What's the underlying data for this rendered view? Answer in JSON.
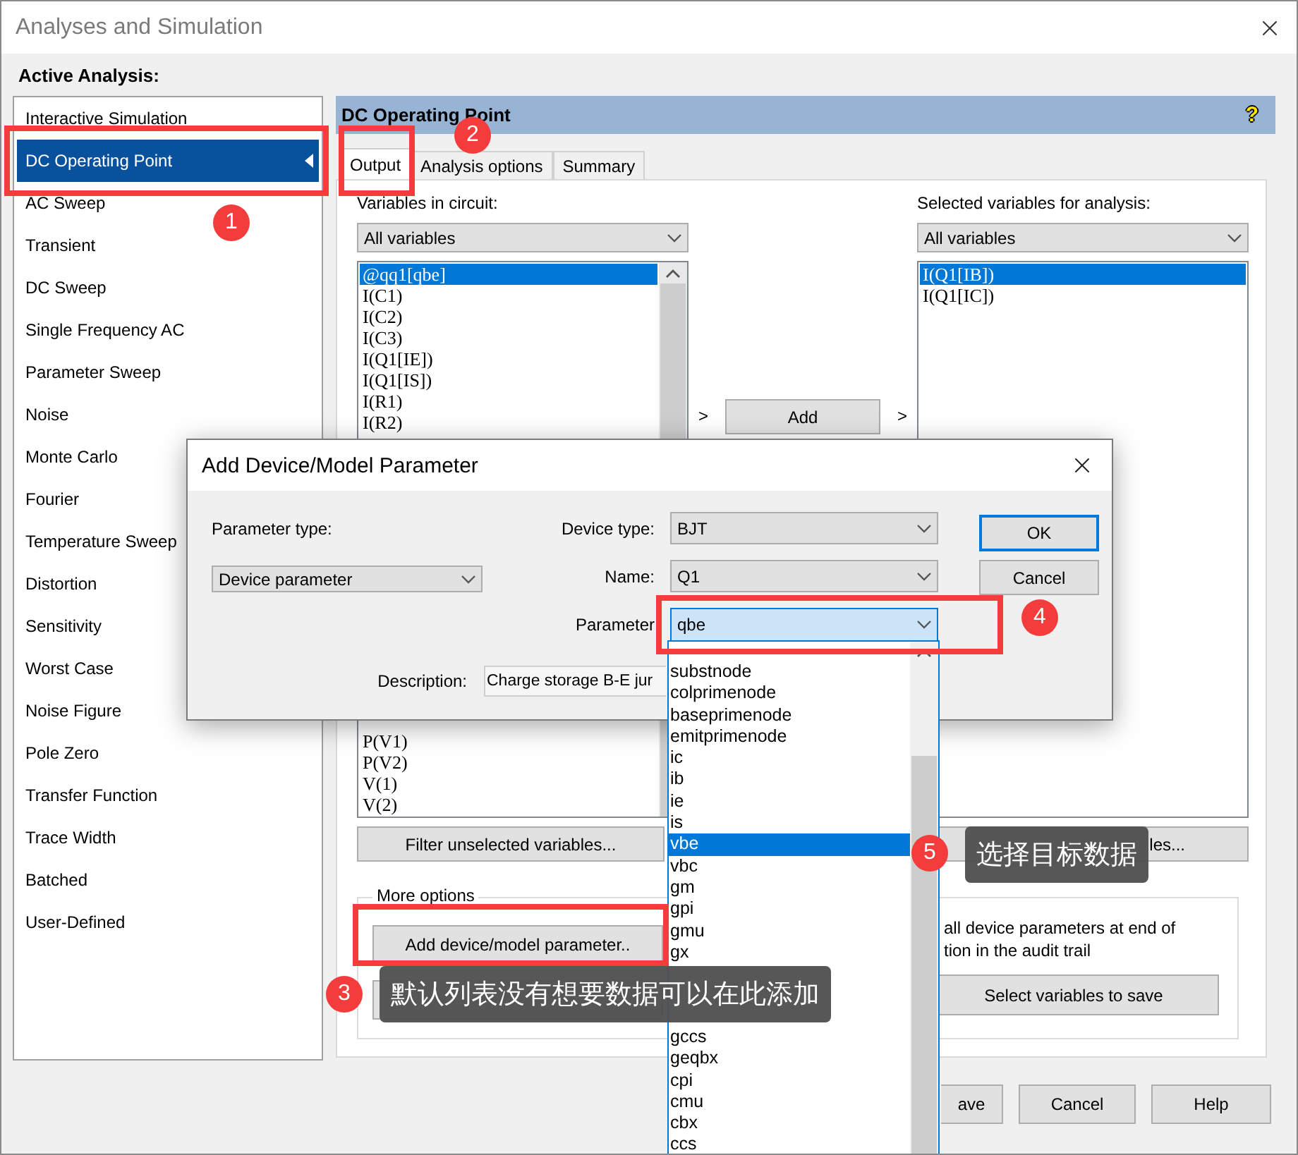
{
  "window": {
    "title": "Analyses and Simulation"
  },
  "active_analysis_label": "Active Analysis:",
  "analyses": [
    {
      "label": "Interactive Simulation",
      "selected": false
    },
    {
      "label": "DC Operating Point",
      "selected": true
    },
    {
      "label": "AC Sweep",
      "selected": false
    },
    {
      "label": "Transient",
      "selected": false
    },
    {
      "label": "DC Sweep",
      "selected": false
    },
    {
      "label": "Single Frequency AC",
      "selected": false
    },
    {
      "label": "Parameter Sweep",
      "selected": false
    },
    {
      "label": "Noise",
      "selected": false
    },
    {
      "label": "Monte Carlo",
      "selected": false
    },
    {
      "label": "Fourier",
      "selected": false
    },
    {
      "label": "Temperature Sweep",
      "selected": false
    },
    {
      "label": "Distortion",
      "selected": false
    },
    {
      "label": "Sensitivity",
      "selected": false
    },
    {
      "label": "Worst Case",
      "selected": false
    },
    {
      "label": "Noise Figure",
      "selected": false
    },
    {
      "label": "Pole Zero",
      "selected": false
    },
    {
      "label": "Transfer Function",
      "selected": false
    },
    {
      "label": "Trace Width",
      "selected": false
    },
    {
      "label": "Batched",
      "selected": false
    },
    {
      "label": "User-Defined",
      "selected": false
    }
  ],
  "panel": {
    "title": "DC Operating Point",
    "help": "?"
  },
  "tabs": [
    {
      "label": "Output",
      "selected": true
    },
    {
      "label": "Analysis options",
      "selected": false
    },
    {
      "label": "Summary",
      "selected": false
    }
  ],
  "variables_in_circuit": {
    "label": "Variables in circuit:",
    "filter": "All variables",
    "items_top": [
      {
        "label": "@qq1[qbe]",
        "selected": true
      },
      {
        "label": "I(C1)",
        "selected": false
      },
      {
        "label": "I(C2)",
        "selected": false
      },
      {
        "label": "I(C3)",
        "selected": false
      },
      {
        "label": "I(Q1[IE])",
        "selected": false
      },
      {
        "label": "I(Q1[IS])",
        "selected": false
      },
      {
        "label": "I(R1)",
        "selected": false
      },
      {
        "label": "I(R2)",
        "selected": false
      }
    ],
    "items_bottom": [
      {
        "label": "P(V1)",
        "selected": false
      },
      {
        "label": "P(V2)",
        "selected": false
      },
      {
        "label": "V(1)",
        "selected": false
      },
      {
        "label": "V(2)",
        "selected": false
      }
    ]
  },
  "add_section": {
    "left_arrow": ">",
    "button": "Add",
    "right_arrow": ">"
  },
  "selected_variables": {
    "label": "Selected variables for analysis:",
    "filter": "All variables",
    "items": [
      {
        "label": "I(Q1[IB])",
        "selected": true
      },
      {
        "label": "I(Q1[IC])",
        "selected": false
      }
    ]
  },
  "filter_buttons": [
    "Filter unselected variables...",
    "les..."
  ],
  "more_options": {
    "legend": "More options",
    "add_button": "Add device/model parameter..",
    "note_lines": [
      "all device parameters at end of",
      "tion in the audit trail"
    ],
    "save_button": "Select variables to save"
  },
  "footer_buttons": [
    "ave",
    "Cancel",
    "Help"
  ],
  "dialog": {
    "title": "Add Device/Model Parameter",
    "parameter_type": {
      "label": "Parameter type:",
      "value": "Device parameter"
    },
    "fields": [
      {
        "label": "Device type:",
        "value": "BJT",
        "focused": false
      },
      {
        "label": "Name:",
        "value": "Q1",
        "focused": false
      },
      {
        "label": "Parameter",
        "value": "qbe",
        "focused": true
      }
    ],
    "buttons": [
      {
        "label": "OK",
        "default": true
      },
      {
        "label": "Cancel",
        "default": false
      }
    ],
    "description": {
      "label": "Description:",
      "value": "Charge storage B-E jur"
    }
  },
  "parameter_list": {
    "items_top": [
      {
        "label": "substnode",
        "selected": false
      },
      {
        "label": "colprimenode",
        "selected": false
      },
      {
        "label": "baseprimenode",
        "selected": false
      },
      {
        "label": "emitprimenode",
        "selected": false
      },
      {
        "label": "ic",
        "selected": false
      },
      {
        "label": "ib",
        "selected": false
      },
      {
        "label": "ie",
        "selected": false
      },
      {
        "label": "is",
        "selected": false
      },
      {
        "label": "vbe",
        "selected": true
      },
      {
        "label": "vbc",
        "selected": false
      },
      {
        "label": "gm",
        "selected": false
      },
      {
        "label": "gpi",
        "selected": false
      },
      {
        "label": "gmu",
        "selected": false
      },
      {
        "label": "gx",
        "selected": false
      }
    ],
    "items_bottom": [
      {
        "label": "gccs",
        "selected": false
      },
      {
        "label": "geqbx",
        "selected": false
      },
      {
        "label": "cpi",
        "selected": false
      },
      {
        "label": "cmu",
        "selected": false
      },
      {
        "label": "cbx",
        "selected": false
      },
      {
        "label": "ccs",
        "selected": false
      }
    ]
  },
  "badges": [
    "1",
    "2",
    "3",
    "4",
    "5"
  ],
  "tooltips": [
    {
      "text": "默认列表没有想要数据可以在此添加"
    },
    {
      "text": "选择目标数据"
    }
  ]
}
